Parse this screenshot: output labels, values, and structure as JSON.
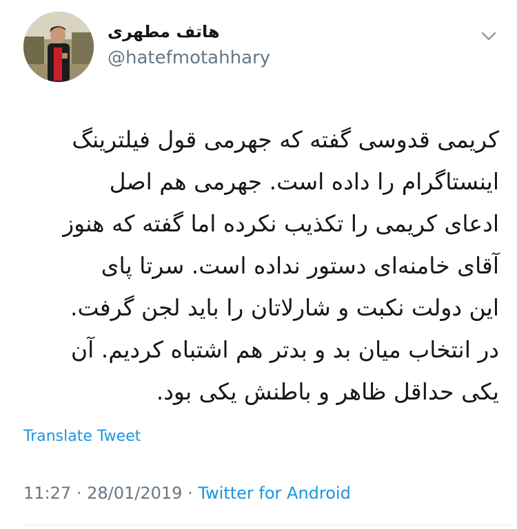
{
  "tweet": {
    "author": {
      "display_name": "هاتف مطهری",
      "handle": "@hatefmotahhary"
    },
    "text": "کریمی قدوسی گفته که جهرمی قول فیلترینگ\nاینستاگرام را داده است. جهرمی هم اصل\nادعای کریمی را تکذیب نکرده اما گفته که هنوز\nآقای خامنه‌ای دستور نداده است. سرتا پای\nاین دولت نکبت و شارلاتان را باید لجن گرفت.\nدر انتخاب میان بد و بدتر هم اشتباه کردیم. آن\nیکی حداقل ظاهر و باطنش یکی بود.",
    "translate_label": "Translate Tweet",
    "time": "11:27",
    "separator": "·",
    "date": "28/01/2019",
    "source": "Twitter for Android"
  },
  "icons": {
    "caret": "chevron-down-icon",
    "avatar": "profile-photo"
  },
  "colors": {
    "link": "#1b95e0",
    "secondary": "#657786",
    "text": "#14171a"
  }
}
